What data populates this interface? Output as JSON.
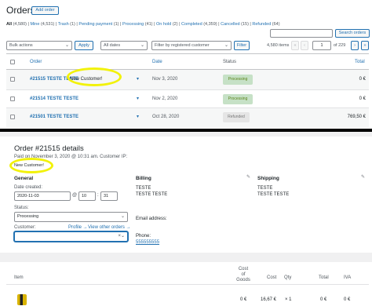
{
  "orders": {
    "title": "Orders",
    "add_order": "Add order",
    "filters": [
      {
        "label": "All",
        "count": "(4,580)"
      },
      {
        "label": "Mine",
        "count": "(4,531)"
      },
      {
        "label": "Trash",
        "count": "(1)"
      },
      {
        "label": "Pending payment",
        "count": "(1)"
      },
      {
        "label": "Processing",
        "count": "(41)"
      },
      {
        "label": "On hold",
        "count": "(2)"
      },
      {
        "label": "Completed",
        "count": "(4,359)"
      },
      {
        "label": "Cancelled",
        "count": "(15)"
      },
      {
        "label": "Refunded",
        "count": "(64)"
      }
    ],
    "search_button": "Search orders",
    "bulk_actions": "Bulk actions",
    "apply": "Apply",
    "all_dates": "All dates",
    "customer_filter_placeholder": "Filter by registered customer",
    "filter_button": "Filter",
    "items_count": "4,580 items",
    "page_current": "1",
    "page_of": "of 229",
    "col_order": "Order",
    "col_date": "Date",
    "col_status": "Status",
    "col_total": "Total",
    "rows": [
      {
        "order": "#21515 TESTE TESTE",
        "note": "New Customer!",
        "date": "Nov 3, 2020",
        "status": "Processing",
        "total": "0 €"
      },
      {
        "order": "#21514 TESTE TESTE",
        "note": "",
        "date": "Nov 2, 2020",
        "status": "Processing",
        "total": "0 €"
      },
      {
        "order": "#21501 TESTE TESTE",
        "note": "",
        "date": "Oct 28, 2020",
        "status": "Refunded",
        "total": "769,50 €"
      }
    ],
    "status_colors": {
      "processing_bg": "#c6e1c6",
      "processing_text": "#5b841b",
      "refunded_bg": "#e5e5e5"
    }
  },
  "details": {
    "title": "Order #21515 details",
    "paid_on": "Paid on November 3, 2020 @ 10:31 am. Customer IP:",
    "new_customer": "New Customer!",
    "general": "General",
    "date_created_label": "Date created:",
    "date_value": "2020-11-03",
    "at": "@",
    "hour": "10",
    "minute": "31",
    "status_label": "Status:",
    "status_value": "Processing",
    "customer_label": "Customer:",
    "profile_link": "Profile →",
    "other_orders_link": "View other orders →",
    "billing": "Billing",
    "billing_name_1": "TESTE",
    "billing_name_2": "TESTE TESTE",
    "email_label": "Email address:",
    "phone_label": "Phone:",
    "phone_value": "555555555",
    "shipping": "Shipping",
    "shipping_name_1": "TESTE",
    "shipping_name_2": "TESTE TESTE"
  },
  "items": {
    "col_item": "Item",
    "col_cost_goods": [
      "Cost",
      "of",
      "Goods"
    ],
    "col_cost": "Cost",
    "col_qty": "Qty",
    "col_total": "Total",
    "col_iva": "IVA",
    "row": {
      "cost_goods": "0 €",
      "cost": "16,67 €",
      "qty": "× 1",
      "total": "0 €",
      "iva": "0 €"
    }
  }
}
